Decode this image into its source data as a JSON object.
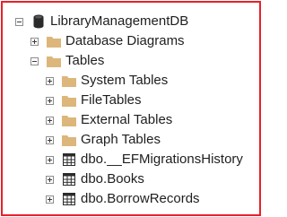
{
  "tree": {
    "root": {
      "label": "LibraryManagementDB",
      "icon": "database-icon",
      "expanded": true
    },
    "database_diagrams": {
      "label": "Database Diagrams",
      "icon": "folder-icon",
      "expanded": false
    },
    "tables": {
      "label": "Tables",
      "icon": "folder-icon",
      "expanded": true
    },
    "system_tables": {
      "label": "System Tables",
      "icon": "folder-icon",
      "expanded": false
    },
    "file_tables": {
      "label": "FileTables",
      "icon": "folder-icon",
      "expanded": false
    },
    "external_tables": {
      "label": "External Tables",
      "icon": "folder-icon",
      "expanded": false
    },
    "graph_tables": {
      "label": "Graph Tables",
      "icon": "folder-icon",
      "expanded": false
    },
    "ef_migrations": {
      "label": "dbo.__EFMigrationsHistory",
      "icon": "table-icon",
      "expanded": false
    },
    "books": {
      "label": "dbo.Books",
      "icon": "table-icon",
      "expanded": false
    },
    "borrow_records": {
      "label": "dbo.BorrowRecords",
      "icon": "table-icon",
      "expanded": false
    }
  },
  "colors": {
    "frame_border": "#e8202a",
    "folder": "#dcb67a",
    "text": "#1e1e1e"
  }
}
